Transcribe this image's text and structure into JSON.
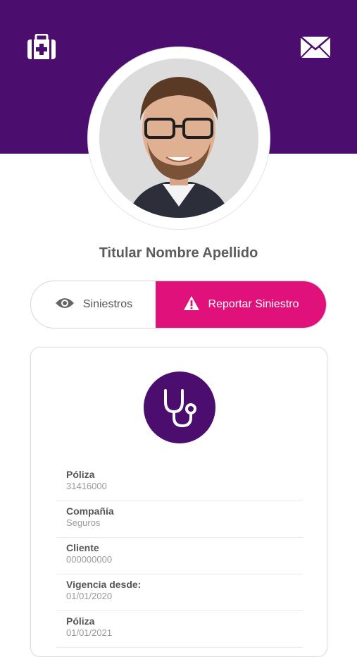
{
  "header": {
    "left_icon": "medical-kit-icon",
    "right_icon": "envelope-icon",
    "background_color": "#4b0d6e"
  },
  "profile": {
    "name": "Titular Nombre Apellido",
    "avatar": "user-photo"
  },
  "segmented_control": {
    "left_label": "Siniestros",
    "left_icon": "eye-icon",
    "right_label": "Reportar Siniestro",
    "right_icon": "warning-icon",
    "accent_color": "#e0117b"
  },
  "card": {
    "icon": "stethoscope-icon",
    "rows": [
      {
        "label": "Póliza",
        "value": "31416000"
      },
      {
        "label": "Compañía",
        "value": "Seguros"
      },
      {
        "label": "Cliente",
        "value": "000000000"
      },
      {
        "label": "Vigencia desde:",
        "value": "01/01/2020"
      },
      {
        "label": "Póliza",
        "value": "01/01/2021"
      }
    ]
  }
}
